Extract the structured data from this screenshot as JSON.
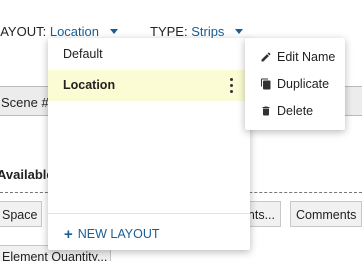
{
  "toolbar": {
    "layout_label": "LAYOUT:",
    "layout_value": "Location",
    "type_label": "TYPE:",
    "type_value": "Strips"
  },
  "background": {
    "scene_header": "Scene #",
    "available_label": "Available I",
    "chips": {
      "space": "Space",
      "props": "nts...",
      "comments": "Comments",
      "element_quantity": "Element Quantity..."
    }
  },
  "layout_menu": {
    "items": [
      {
        "label": "Default",
        "selected": false
      },
      {
        "label": "Location",
        "selected": true
      }
    ],
    "new_layout_label": "NEW LAYOUT"
  },
  "context_menu": {
    "items": [
      {
        "label": "Edit Name",
        "icon": "pencil-icon"
      },
      {
        "label": "Duplicate",
        "icon": "copy-icon"
      },
      {
        "label": "Delete",
        "icon": "trash-icon"
      }
    ]
  },
  "colors": {
    "accent": "#1a5e93",
    "selected_row": "#fbfbd4"
  }
}
